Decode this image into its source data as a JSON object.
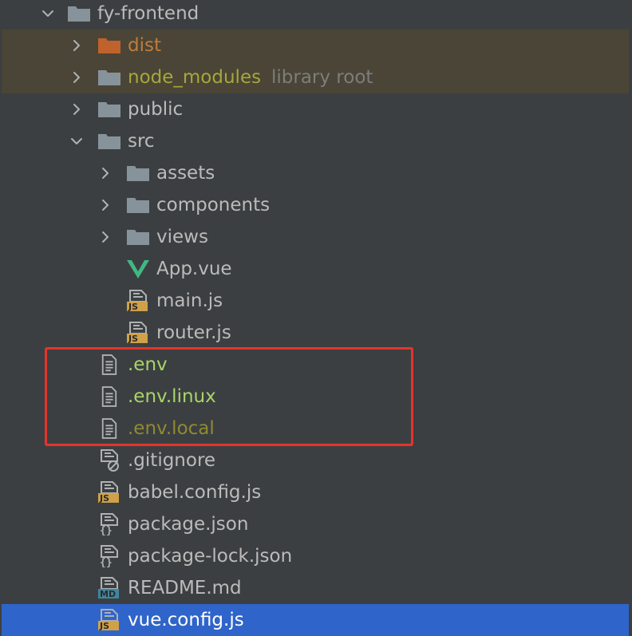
{
  "project_tree": {
    "root": {
      "label": "fy-frontend",
      "icon": "folder-icon",
      "expanded": true
    },
    "items": [
      {
        "label": "dist",
        "icon": "folder-icon",
        "kind": "excluded-folder",
        "expanded": false
      },
      {
        "label": "node_modules",
        "hint": "library root",
        "icon": "folder-icon",
        "kind": "library-folder",
        "expanded": false
      },
      {
        "label": "public",
        "icon": "folder-icon",
        "kind": "folder",
        "expanded": false
      },
      {
        "label": "src",
        "icon": "folder-icon",
        "kind": "folder",
        "expanded": true
      },
      {
        "label": "assets",
        "icon": "folder-icon",
        "kind": "folder",
        "expanded": false
      },
      {
        "label": "components",
        "icon": "folder-icon",
        "kind": "folder",
        "expanded": false
      },
      {
        "label": "views",
        "icon": "folder-icon",
        "kind": "folder",
        "expanded": false
      },
      {
        "label": "App.vue",
        "icon": "vue-file-icon",
        "kind": "file"
      },
      {
        "label": "main.js",
        "icon": "js-file-icon",
        "kind": "file"
      },
      {
        "label": "router.js",
        "icon": "js-file-icon",
        "kind": "file"
      },
      {
        "label": ".env",
        "icon": "text-file-icon",
        "kind": "file-new"
      },
      {
        "label": ".env.linux",
        "icon": "text-file-icon",
        "kind": "file-new"
      },
      {
        "label": ".env.local",
        "icon": "text-file-icon",
        "kind": "file-ignored"
      },
      {
        "label": ".gitignore",
        "icon": "ignore-file-icon",
        "kind": "file"
      },
      {
        "label": "babel.config.js",
        "icon": "js-file-icon",
        "kind": "file"
      },
      {
        "label": "package.json",
        "icon": "json-file-icon",
        "kind": "file"
      },
      {
        "label": "package-lock.json",
        "icon": "json-file-icon",
        "kind": "file"
      },
      {
        "label": "README.md",
        "icon": "markdown-file-icon",
        "kind": "file"
      },
      {
        "label": "vue.config.js",
        "icon": "js-file-icon",
        "kind": "file-selected"
      }
    ],
    "icon_badges": {
      "js": "JS",
      "md": "MD"
    }
  },
  "colors": {
    "background": "#3c3f41",
    "excluded_row": "#4a4536",
    "selected_row": "#2f65ca",
    "highlight_box": "#e5342b",
    "folder": "#87939a",
    "excluded_folder": "#c0622c",
    "vue": "#41b883",
    "js_badge": "#d0a148",
    "md_badge": "#3e86a0"
  }
}
